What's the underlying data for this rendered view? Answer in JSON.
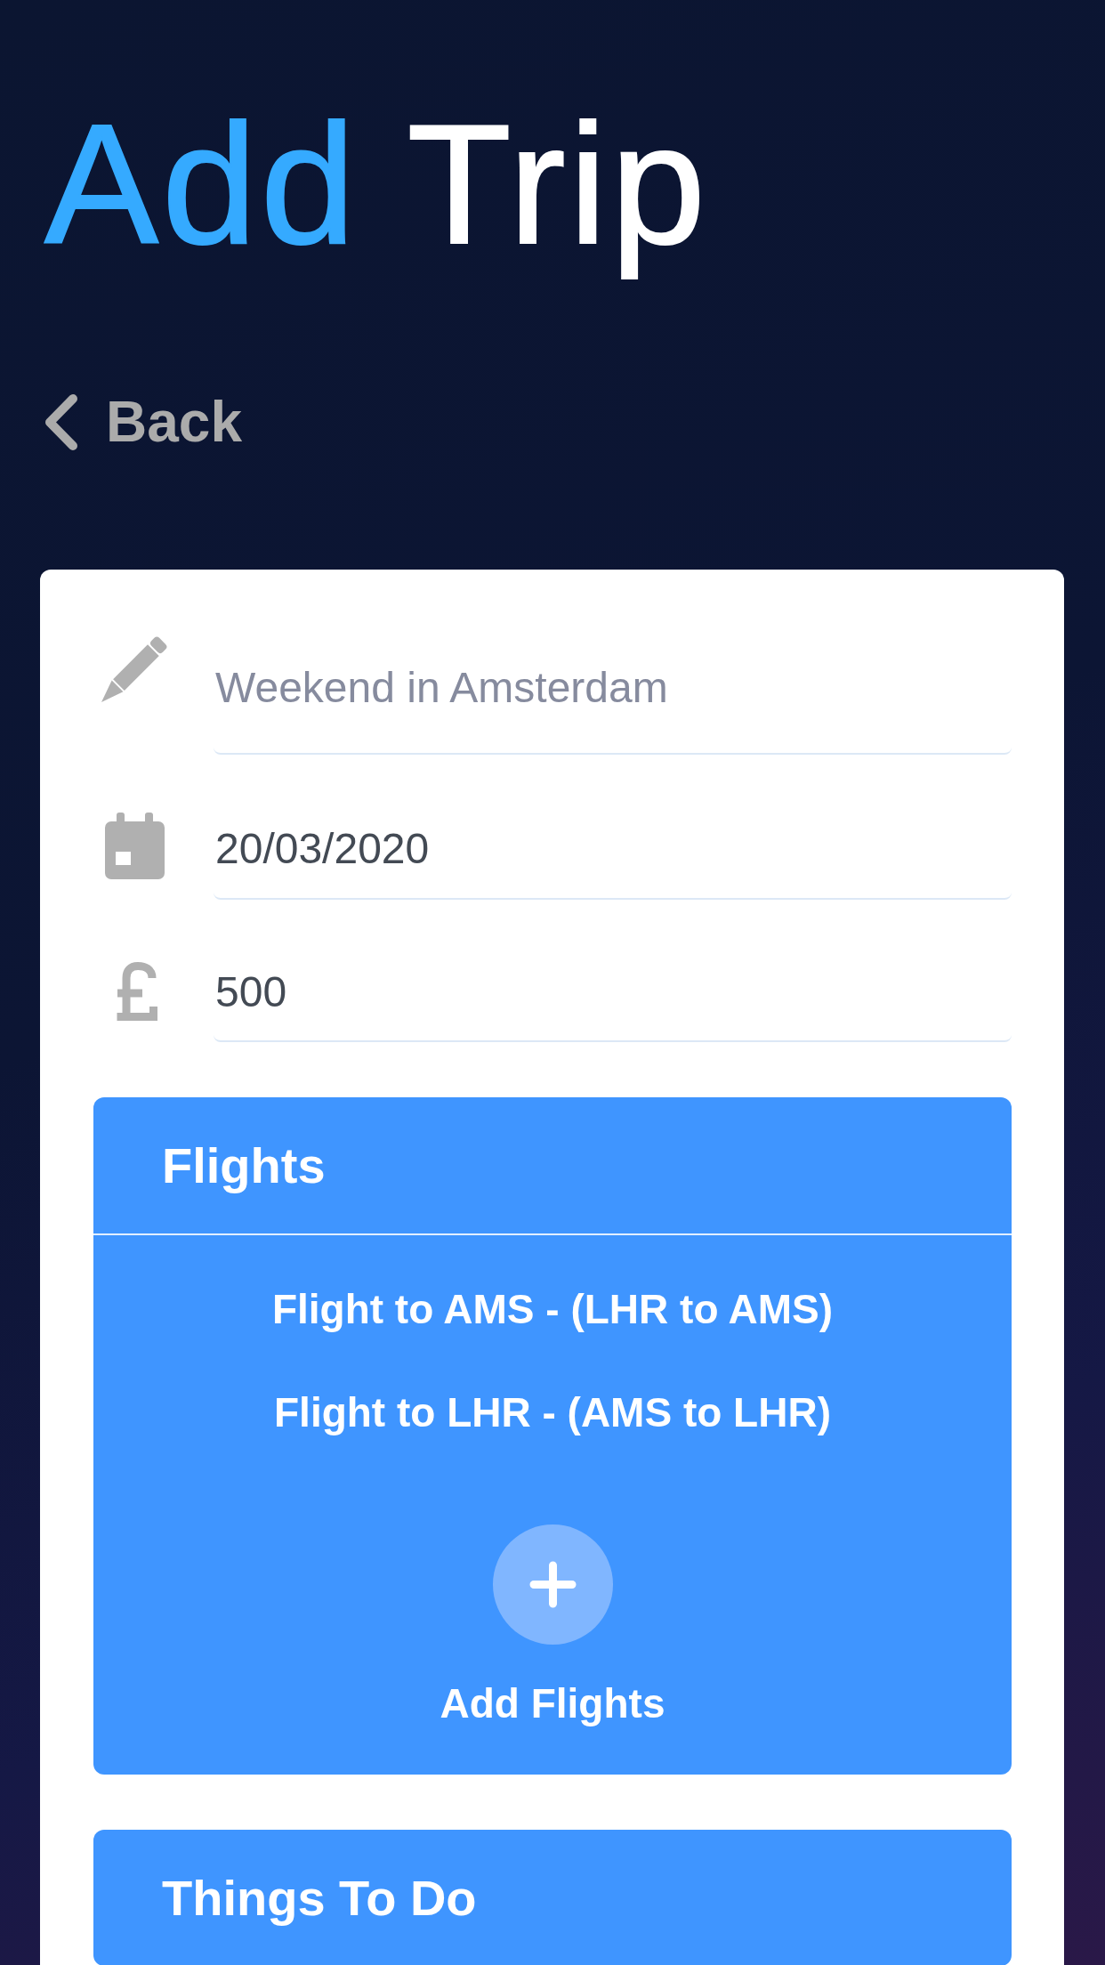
{
  "title": {
    "accent": "Add",
    "text": "Trip"
  },
  "back_link": {
    "label": "Back"
  },
  "form": {
    "fields": [
      {
        "kind": "name",
        "placeholder": "Weekend in Amsterdam"
      },
      {
        "kind": "date",
        "value": "20/03/2020"
      },
      {
        "kind": "budget",
        "value": "500"
      }
    ],
    "sections": [
      {
        "title": "Flights",
        "items": [
          "Flight to AMS - (LHR to AMS)",
          "Flight to LHR - (AMS to LHR)"
        ],
        "add_label": "Add Flights"
      },
      {
        "title": "Things To Do"
      }
    ]
  }
}
